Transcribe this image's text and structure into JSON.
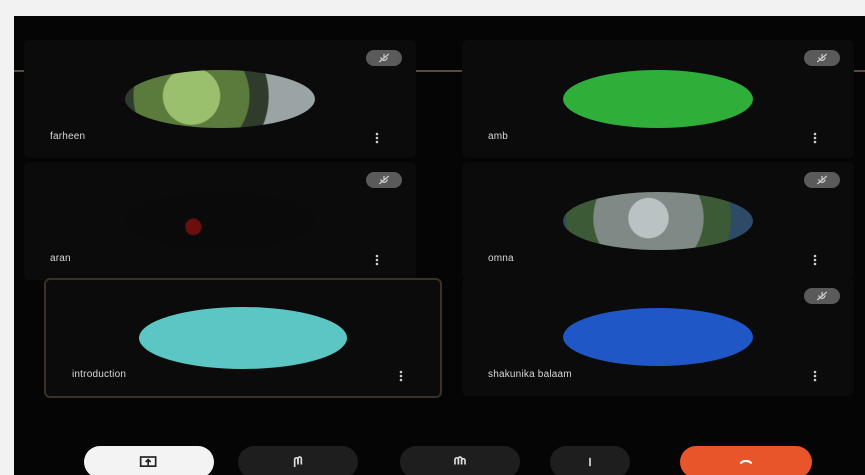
{
  "tiles": [
    {
      "name": "farheen",
      "thumb": "landscape-photo",
      "color": "#6f8c52"
    },
    {
      "name": "amb",
      "thumb": "solid",
      "color": "#2fae3a"
    },
    {
      "name": "aran",
      "thumb": "dark",
      "color": "#0a0a0a"
    },
    {
      "name": "omna",
      "thumb": "texture",
      "color": "#7f8a86"
    },
    {
      "name": "introduction",
      "thumb": "solid",
      "color": "#5bc6c3"
    },
    {
      "name": "shakunika balaam",
      "thumb": "solid",
      "color": "#1f57c7"
    }
  ],
  "icons": {
    "mic": "mic-muted-icon",
    "more": "more-vert-icon",
    "present": "present-screen-icon",
    "raise": "raise-hand-icon",
    "reactions": "reaction-icon",
    "captions": "captions-icon",
    "leave": "end-call-icon"
  },
  "colors": {
    "background": "#050505",
    "tile": "#0b0b0b",
    "leave_red": "#e8552b",
    "present_white": "#f3f3f3",
    "control_gray": "#1e1e1e"
  }
}
